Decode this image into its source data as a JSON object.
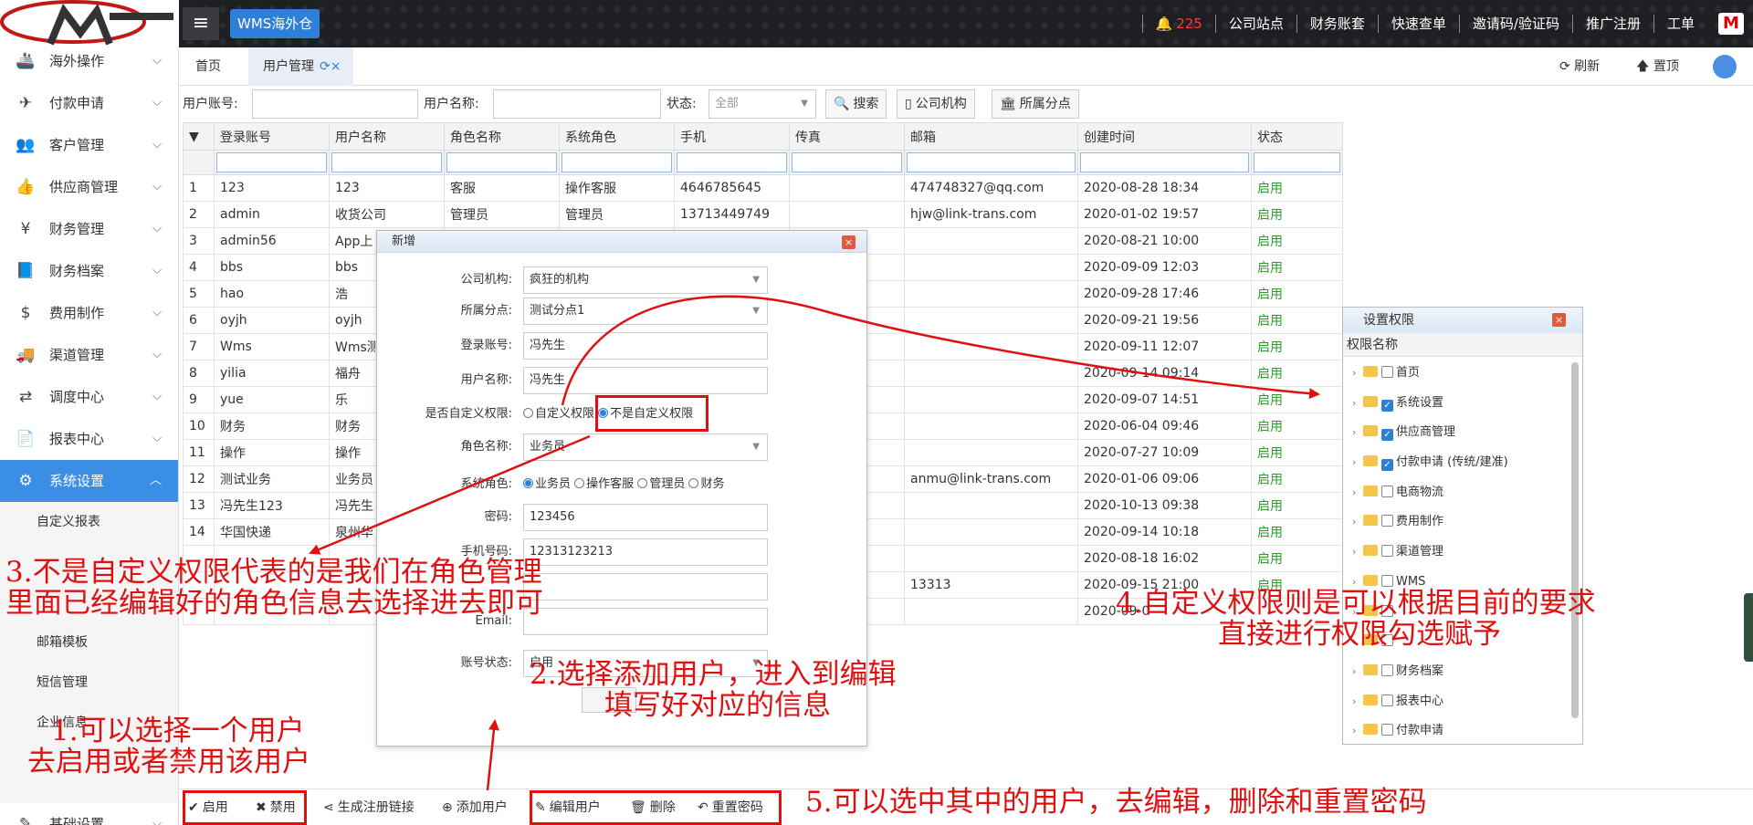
{
  "topbar": {
    "menu_icon": "≡",
    "app_tag": "WMS海外仓",
    "bell_icon": "🔔",
    "alert_count": "225",
    "nav": [
      "公司站点",
      "财务账套",
      "快速查单",
      "邀请码/验证码",
      "推广注册",
      "工单"
    ],
    "logo_mark": "M"
  },
  "sidebar": {
    "items": [
      {
        "icon": "🚢",
        "label": "海外操作"
      },
      {
        "icon": "✈",
        "label": "付款申请"
      },
      {
        "icon": "👥",
        "label": "客户管理"
      },
      {
        "icon": "👍",
        "label": "供应商管理"
      },
      {
        "icon": "¥",
        "label": "财务管理"
      },
      {
        "icon": "📘",
        "label": "财务档案"
      },
      {
        "icon": "$",
        "label": "费用制作"
      },
      {
        "icon": "🚚",
        "label": "渠道管理"
      },
      {
        "icon": "⇄",
        "label": "调度中心"
      },
      {
        "icon": "📄",
        "label": "报表中心"
      },
      {
        "icon": "⚙",
        "label": "系统设置"
      }
    ],
    "subitems": [
      "自定义报表",
      "邮箱模板",
      "短信管理",
      "企业信息"
    ],
    "bottom": {
      "icon": "✎",
      "label": "基础设置"
    },
    "chevron_down": "⌵",
    "chevron_up": "︿"
  },
  "tabs": {
    "home": "首页",
    "user": "用户管理",
    "reload_icon": "⟳",
    "close_icon": "×",
    "refresh": "⟳ 刷新",
    "top": "🡅 置顶"
  },
  "search": {
    "account_label": "用户账号:",
    "name_label": "用户名称:",
    "status_label": "状态:",
    "status_value": "全部",
    "search_btn": "搜索",
    "company_btn": "公司机构",
    "branch_btn": "所属分点",
    "search_icon": "🔍",
    "company_icon": "▯",
    "branch_icon": "🏛"
  },
  "table": {
    "filter_icon": "▼",
    "headers": [
      "登录账号",
      "用户名称",
      "角色名称",
      "系统角色",
      "手机",
      "传真",
      "邮箱",
      "创建时间",
      "状态"
    ],
    "rows": [
      [
        "1",
        "123",
        "123",
        "客服",
        "操作客服",
        "4646785645",
        "",
        "474748327@qq.com",
        "2020-08-28 18:34",
        "启用"
      ],
      [
        "2",
        "admin",
        "收货公司",
        "管理员",
        "管理员",
        "13713449749",
        "",
        "hjw@link-trans.com",
        "2020-01-02 19:57",
        "启用"
      ],
      [
        "3",
        "admin56",
        "App上",
        "",
        "",
        "",
        "",
        "",
        "2020-08-21 10:00",
        "启用"
      ],
      [
        "4",
        "bbs",
        "bbs",
        "",
        "",
        "",
        "",
        "",
        "2020-09-09 12:03",
        "启用"
      ],
      [
        "5",
        "hao",
        "浩",
        "",
        "",
        "",
        "",
        "",
        "2020-09-28 17:46",
        "启用"
      ],
      [
        "6",
        "oyjh",
        "oyjh",
        "",
        "",
        "",
        "",
        "",
        "2020-09-21 19:56",
        "启用"
      ],
      [
        "7",
        "Wms",
        "Wms测",
        "",
        "",
        "",
        "",
        "",
        "2020-09-11 12:07",
        "启用"
      ],
      [
        "8",
        "yilia",
        "福舟",
        "",
        "",
        "",
        "",
        "",
        "2020-09-14 09:14",
        "启用"
      ],
      [
        "9",
        "yue",
        "乐",
        "",
        "",
        "",
        "",
        "",
        "2020-09-07 14:51",
        "启用"
      ],
      [
        "10",
        "财务",
        "财务",
        "",
        "",
        "",
        "",
        "",
        "2020-06-04 09:46",
        "启用"
      ],
      [
        "11",
        "操作",
        "操作",
        "",
        "",
        "",
        "",
        "",
        "2020-07-27 10:09",
        "启用"
      ],
      [
        "12",
        "测试业务",
        "业务员",
        "",
        "",
        "",
        "",
        "anmu@link-trans.com",
        "2020-01-06 09:06",
        "启用"
      ],
      [
        "13",
        "冯先生123",
        "冯先生",
        "",
        "",
        "",
        "",
        "",
        "2020-10-13 09:38",
        "启用"
      ],
      [
        "14",
        "华国快递",
        "泉州华",
        "",
        "",
        "",
        "",
        "",
        "2020-09-14 10:18",
        "启用"
      ],
      [
        "",
        "",
        "",
        "",
        "",
        "",
        "",
        "",
        "2020-08-18 16:02",
        "启用"
      ],
      [
        "",
        "",
        "",
        "",
        "",
        "",
        "",
        "13313",
        "2020-09-15 21:00",
        "启用"
      ],
      [
        "",
        "",
        "",
        "",
        "",
        "",
        "",
        "",
        "2020-09-0",
        ""
      ]
    ]
  },
  "add_dialog": {
    "title": "新增",
    "close": "×",
    "company_label": "公司机构:",
    "company_value": "疯狂的机构",
    "branch_label": "所属分点:",
    "branch_value": "测试分点1",
    "account_label": "登录账号:",
    "account_value": "冯先生",
    "name_label": "用户名称:",
    "name_value": "冯先生",
    "custom_label": "是否自定义权限:",
    "custom_yes": "自定义权限",
    "custom_no": "不是自定义权限",
    "role_label": "角色名称:",
    "role_value": "业务员",
    "sysrole_label": "系统角色:",
    "sysroles": [
      "业务员",
      "操作客服",
      "管理员",
      "财务"
    ],
    "password_label": "密码:",
    "password_value": "123456",
    "phone_label": "手机号码:",
    "phone_value": "12313123213",
    "email_label": "Email:",
    "acct_status_label": "账号状态:",
    "acct_status_value": "启用"
  },
  "perm_dialog": {
    "title": "设置权限",
    "close": "×",
    "header": "权限名称",
    "tri": "›",
    "check": "✓",
    "items": [
      {
        "label": "首页",
        "checked": false
      },
      {
        "label": "系统设置",
        "checked": true
      },
      {
        "label": "供应商管理",
        "checked": true
      },
      {
        "label": "付款申请 (传统/建准)",
        "checked": true
      },
      {
        "label": "电商物流",
        "checked": false
      },
      {
        "label": "费用制作",
        "checked": false
      },
      {
        "label": "渠道管理",
        "checked": false
      },
      {
        "label": "WMS",
        "checked": false
      },
      {
        "label": "",
        "checked": false
      },
      {
        "label": "",
        "checked": false
      },
      {
        "label": "财务档案",
        "checked": false
      },
      {
        "label": "报表中心",
        "checked": false
      },
      {
        "label": "付款申请",
        "checked": false
      }
    ]
  },
  "bottombar": {
    "enable": "启用",
    "disable": "禁用",
    "reg_link": "生成注册链接",
    "add_user": "添加用户",
    "edit_user": "编辑用户",
    "delete": "删除",
    "reset_pwd": "重置密码",
    "enable_icon": "✔",
    "disable_icon": "✖",
    "share_icon": "⋖",
    "add_icon": "⊕",
    "edit_icon": "✎",
    "delete_icon": "🗑",
    "reset_icon": "↶"
  },
  "annotations": {
    "a1_line1": "1.可以选择一个用户",
    "a1_line2": "去启用或者禁用该用户",
    "a2_line1": "2.选择添加用户，进入到编辑",
    "a2_line2": "填写好对应的信息",
    "a3_line1": "3.不是自定义权限代表的是我们在角色管理",
    "a3_line2": "里面已经编辑好的角色信息去选择进去即可",
    "a4_line1": "4.自定义权限则是可以根据目前的要求",
    "a4_line2": "直接进行权限勾选赋予",
    "a5": "5.可以选中其中的用户，去编辑，删除和重置密码",
    "color": "#e01010"
  }
}
